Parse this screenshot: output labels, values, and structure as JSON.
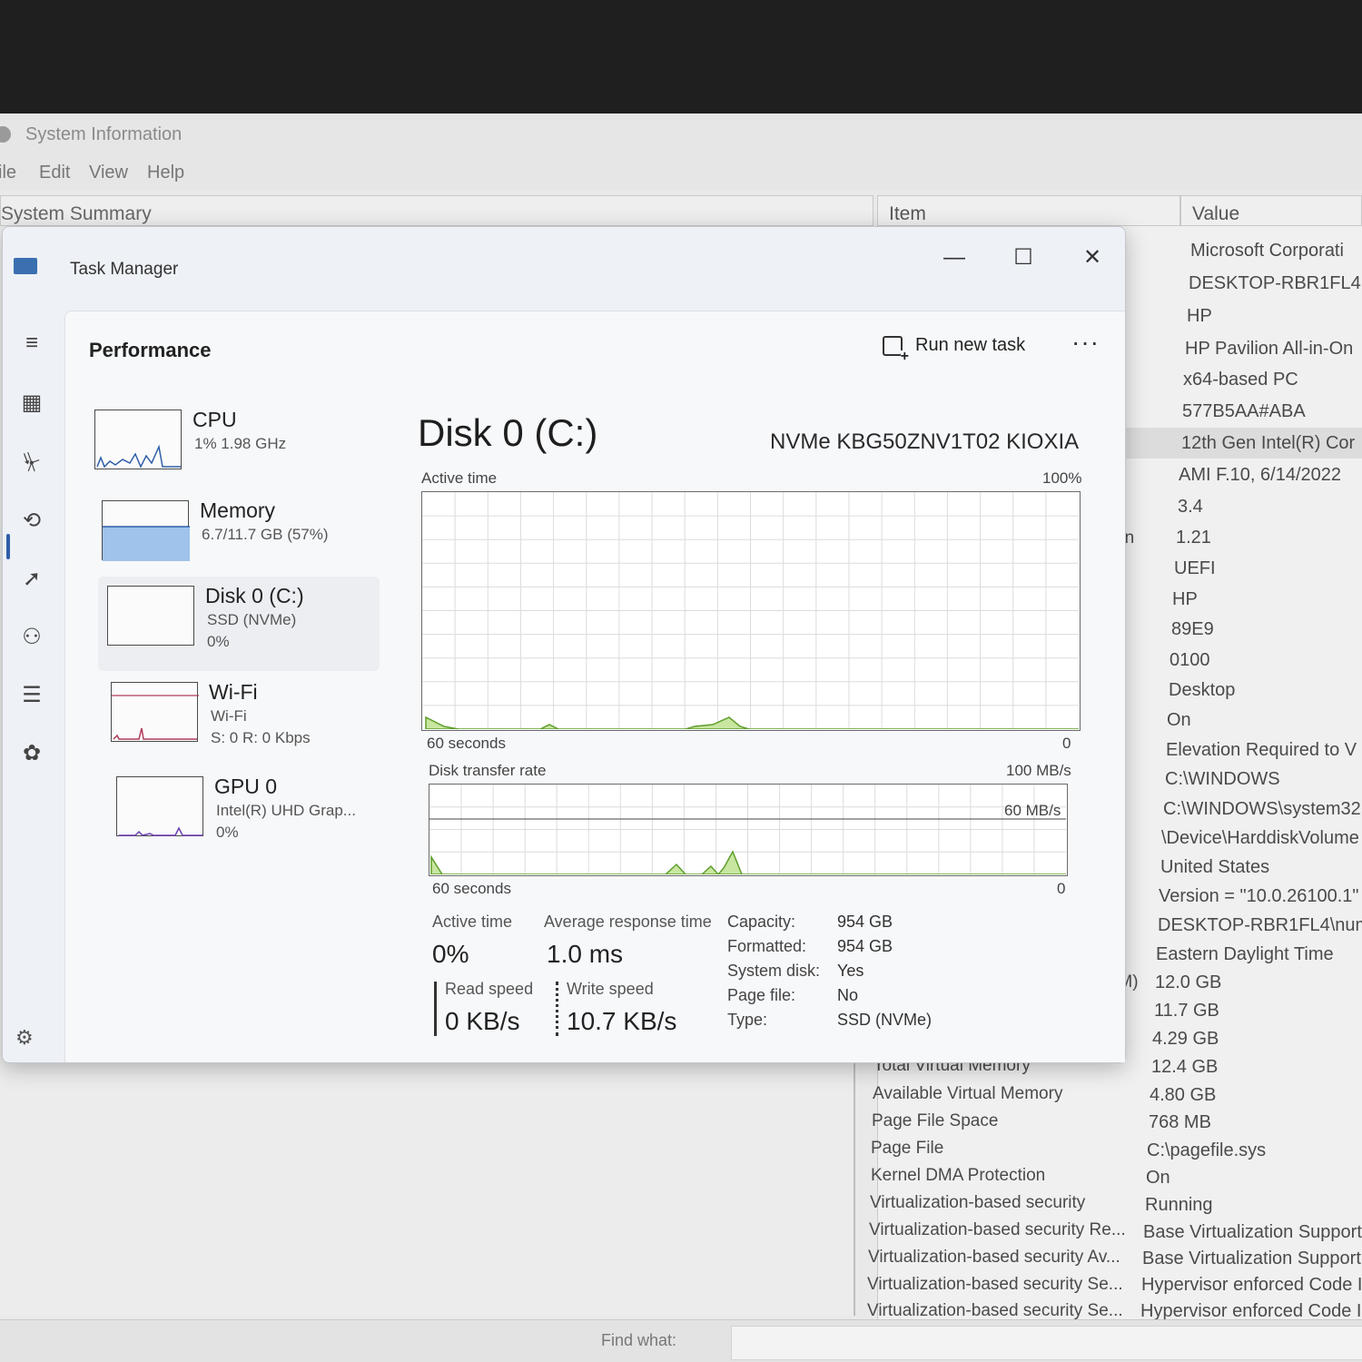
{
  "system_info": {
    "window_title": "System Information",
    "menu": [
      "ile",
      "Edit",
      "View",
      "Help"
    ],
    "tree_header": "System Summary",
    "col_item": "Item",
    "col_value": "Value",
    "values": [
      "Microsoft Corporati",
      "DESKTOP-RBR1FL4",
      "HP",
      "HP Pavilion All-in-On",
      "x64-based PC",
      "577B5AA#ABA",
      "12th Gen Intel(R) Cor",
      "AMI F.10, 6/14/2022",
      "3.4",
      "1.21",
      "UEFI",
      "HP",
      "89E9",
      "0100",
      "Desktop",
      "On",
      "Elevation Required to V",
      "C:\\WINDOWS",
      "C:\\WINDOWS\\system32",
      "\\Device\\HarddiskVolume",
      "United States",
      "Version = \"10.0.26100.1\"",
      "DESKTOP-RBR1FL4\\numb",
      "Eastern Daylight Time",
      "12.0 GB",
      "11.7 GB",
      "4.29 GB",
      "12.4 GB",
      "4.80 GB",
      "768 MB",
      "C:\\pagefile.sys",
      "On",
      "Running",
      "Base Virtualization Support",
      "Base Virtualization Support,",
      "Hypervisor enforced Code In",
      "Hypervisor enforced Code In"
    ],
    "item_fragments": [
      "on",
      "r",
      "RAM)"
    ],
    "items": [
      "Total Virtual Memory",
      "Available Virtual Memory",
      "Page File Space",
      "Page File",
      "Kernel DMA Protection",
      "Virtualization-based security",
      "Virtualization-based security Re...",
      "Virtualization-based security Av...",
      "Virtualization-based security Se...",
      "Virtualization-based security Se..."
    ],
    "find_label": "Find what:"
  },
  "task_manager": {
    "title": "Task Manager",
    "controls": {
      "minimize": "—",
      "maximize": "☐",
      "close": "✕"
    },
    "header": "Performance",
    "run_new_task": "Run new task",
    "more": "···",
    "resources": [
      {
        "name": "CPU",
        "sub1": "1% 1.98 GHz",
        "sub2": ""
      },
      {
        "name": "Memory",
        "sub1": "6.7/11.7 GB (57%)",
        "sub2": ""
      },
      {
        "name": "Disk 0 (C:)",
        "sub1": "SSD (NVMe)",
        "sub2": "0%"
      },
      {
        "name": "Wi-Fi",
        "sub1": "Wi-Fi",
        "sub2": "S: 0 R: 0 Kbps"
      },
      {
        "name": "GPU 0",
        "sub1": "Intel(R) UHD Grap...",
        "sub2": "0%"
      }
    ],
    "disk": {
      "title": "Disk 0 (C:)",
      "model": "NVMe KBG50ZNV1T02 KIOXIA",
      "active_time_label": "Active time",
      "active_time_max": "100%",
      "active_time_xlabel": "60 seconds",
      "active_time_xmin": "0",
      "transfer_label": "Disk transfer rate",
      "transfer_max": "100 MB/s",
      "transfer_mid": "60 MB/s",
      "transfer_xlabel": "60 seconds",
      "transfer_xmin": "0",
      "stats": {
        "active_time_label": "Active time",
        "active_time_value": "0%",
        "avg_resp_label": "Average response time",
        "avg_resp_value": "1.0 ms",
        "read_label": "Read speed",
        "read_value": "0 KB/s",
        "write_label": "Write speed",
        "write_value": "10.7 KB/s"
      },
      "props": [
        {
          "k": "Capacity:",
          "v": "954 GB"
        },
        {
          "k": "Formatted:",
          "v": "954 GB"
        },
        {
          "k": "System disk:",
          "v": "Yes"
        },
        {
          "k": "Page file:",
          "v": "No"
        },
        {
          "k": "Type:",
          "v": "SSD (NVMe)"
        }
      ]
    },
    "colors": {
      "disk_fill": "#c8e6a0",
      "disk_line": "#5e9e2a",
      "memory_fill": "#9fc3ea",
      "accent": "#2f5ea8"
    }
  }
}
